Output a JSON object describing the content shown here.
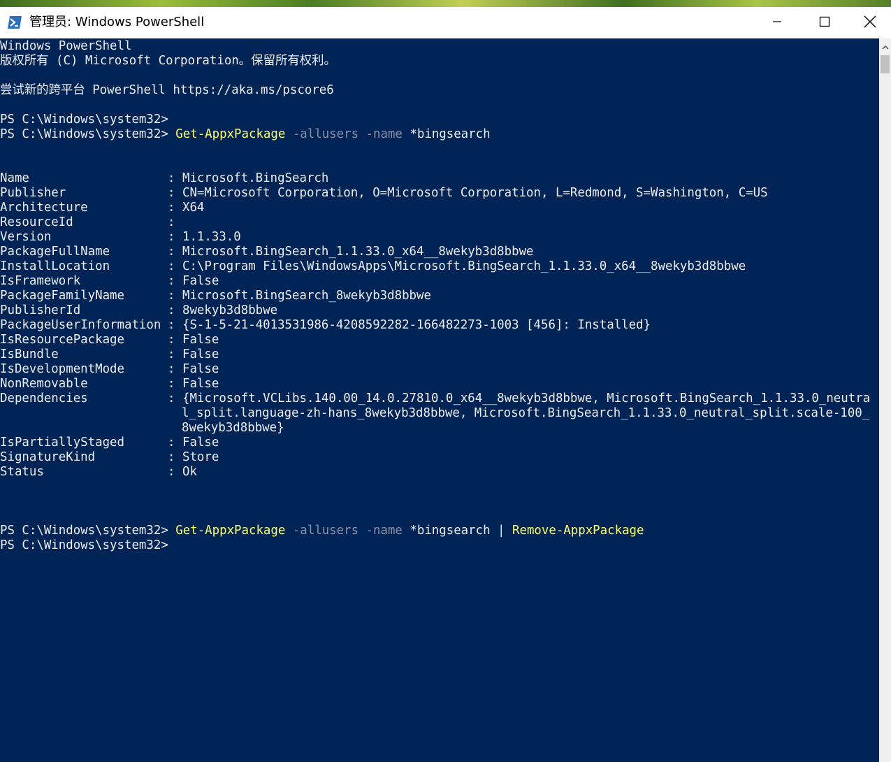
{
  "window": {
    "title": "管理员: Windows PowerShell",
    "icon": "powershell-icon",
    "controls": [
      "minimize-icon",
      "maximize-icon",
      "close-icon"
    ]
  },
  "console": {
    "banner": [
      "Windows PowerShell",
      "版权所有 (C) Microsoft Corporation。保留所有权利。",
      "尝试新的跨平台 PowerShell https://aka.ms/pscore6"
    ],
    "prompt": "PS C:\\Windows\\system32> ",
    "command1": {
      "cmdlet": "Get-AppxPackage",
      "param1": "-allusers",
      "param2": "-name",
      "arg": "*bingsearch"
    },
    "properties": [
      {
        "name": "Name",
        "value": "Microsoft.BingSearch"
      },
      {
        "name": "Publisher",
        "value": "CN=Microsoft Corporation, O=Microsoft Corporation, L=Redmond, S=Washington, C=US"
      },
      {
        "name": "Architecture",
        "value": "X64"
      },
      {
        "name": "ResourceId",
        "value": ""
      },
      {
        "name": "Version",
        "value": "1.1.33.0"
      },
      {
        "name": "PackageFullName",
        "value": "Microsoft.BingSearch_1.1.33.0_x64__8wekyb3d8bbwe"
      },
      {
        "name": "InstallLocation",
        "value": "C:\\Program Files\\WindowsApps\\Microsoft.BingSearch_1.1.33.0_x64__8wekyb3d8bbwe"
      },
      {
        "name": "IsFramework",
        "value": "False"
      },
      {
        "name": "PackageFamilyName",
        "value": "Microsoft.BingSearch_8wekyb3d8bbwe"
      },
      {
        "name": "PublisherId",
        "value": "8wekyb3d8bbwe"
      },
      {
        "name": "PackageUserInformation",
        "value": "{S-1-5-21-4013531986-4208592282-166482273-1003 [456]: Installed}"
      },
      {
        "name": "IsResourcePackage",
        "value": "False"
      },
      {
        "name": "IsBundle",
        "value": "False"
      },
      {
        "name": "IsDevelopmentMode",
        "value": "False"
      },
      {
        "name": "NonRemovable",
        "value": "False"
      },
      {
        "name": "Dependencies",
        "value": "{Microsoft.VCLibs.140.00_14.0.27810.0_x64__8wekyb3d8bbwe, Microsoft.BingSearch_1.1.33.0_neutra",
        "cont": [
          "l_split.language-zh-hans_8wekyb3d8bbwe, Microsoft.BingSearch_1.1.33.0_neutral_split.scale-100_",
          "8wekyb3d8bbwe}"
        ]
      },
      {
        "name": "IsPartiallyStaged",
        "value": "False"
      },
      {
        "name": "SignatureKind",
        "value": "Store"
      },
      {
        "name": "Status",
        "value": "Ok"
      }
    ],
    "separator": ":",
    "command2": {
      "cmdlet": "Get-AppxPackage",
      "param1": "-allusers",
      "param2": "-name",
      "arg": "*bingsearch",
      "pipe": "|",
      "cmdlet2": "Remove-AppxPackage"
    }
  },
  "colors": {
    "console_bg": "#012456",
    "text": "#eeedf0",
    "cmdlet": "#ffff66",
    "parameter": "#8b8fa6"
  }
}
